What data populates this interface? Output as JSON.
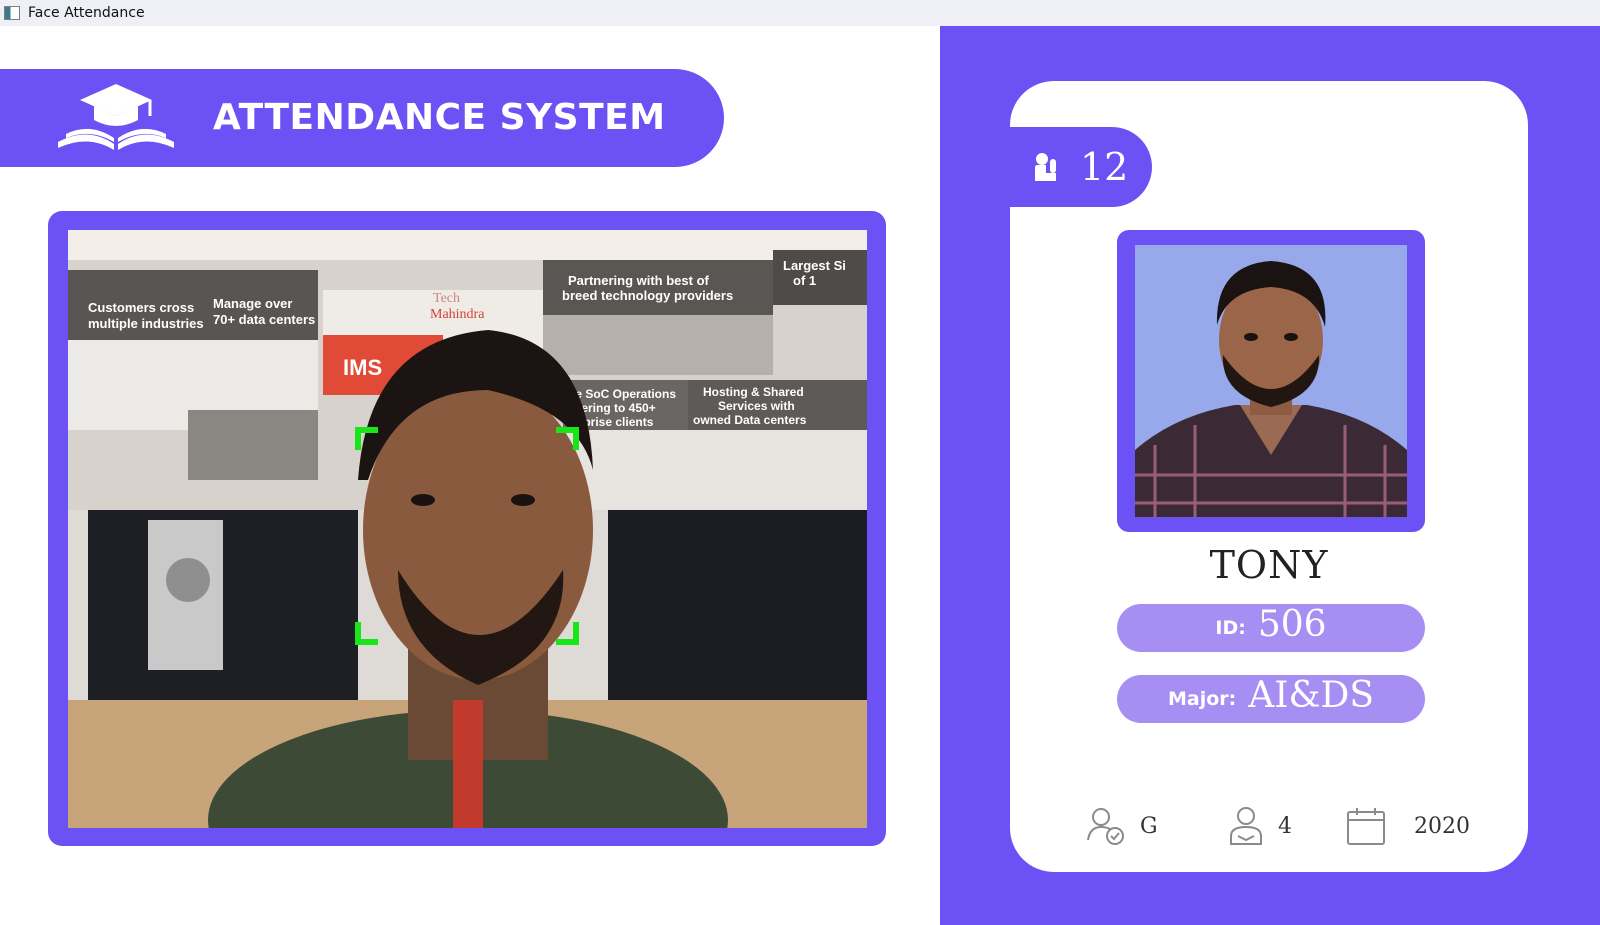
{
  "window": {
    "title": "Face Attendance",
    "app_icon": "window-app-icon"
  },
  "header": {
    "title": "ATTENDANCE SYSTEM",
    "logo_icon": "graduation-cap-book-icon"
  },
  "camera": {
    "content": "live-webcam-feed",
    "face_box_color": "#19e619"
  },
  "student": {
    "attendance_count": "12",
    "name": "TONY",
    "id_label": "ID:",
    "id_value": "506",
    "major_label": "Major:",
    "major_value": "AI&DS",
    "standing": "G",
    "year_of_study": "4",
    "starting_year": "2020"
  },
  "colors": {
    "primary": "#6c51f4",
    "pill": "#a68ef3",
    "photo_background": "#97a9ea"
  }
}
